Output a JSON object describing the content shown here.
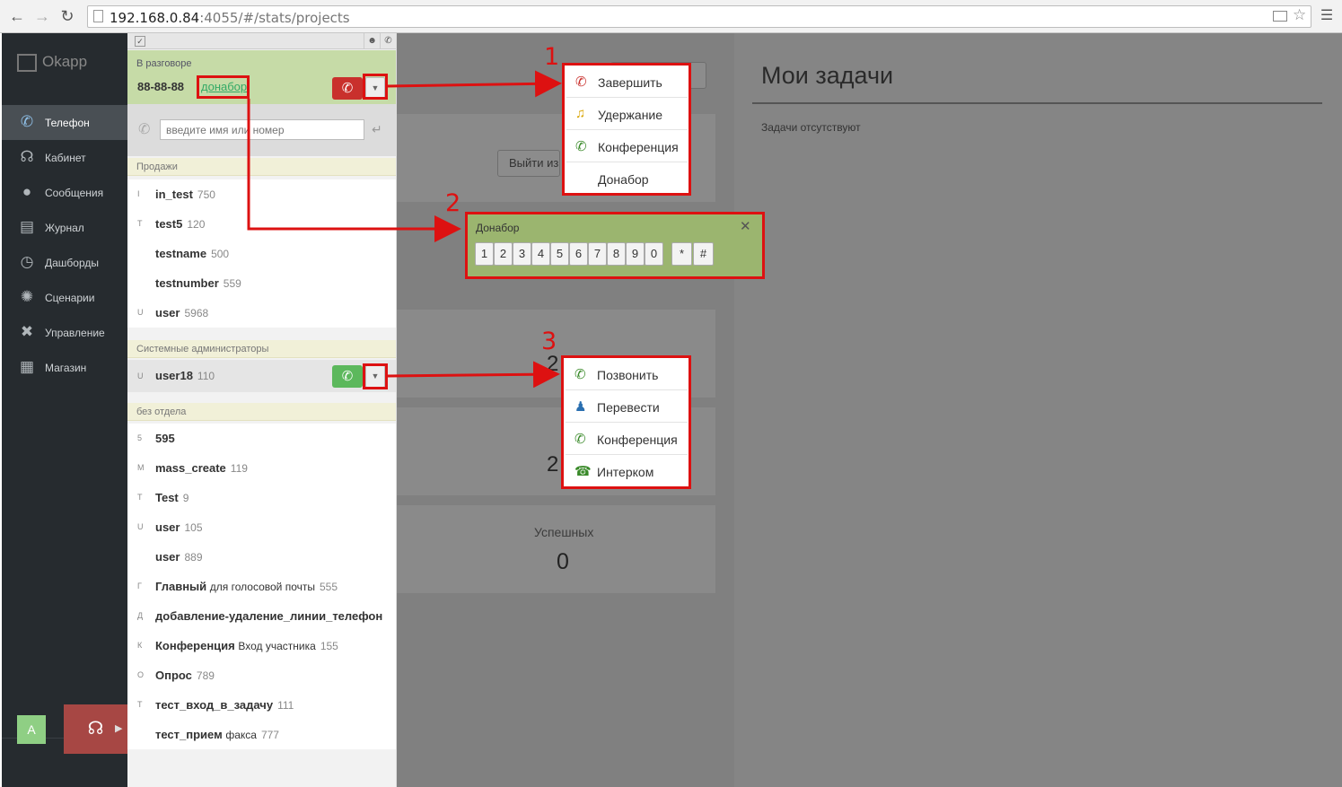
{
  "browser": {
    "url_host": "192.168.0.84",
    "url_path": ":4055/#/stats/projects"
  },
  "nav": {
    "logo": "Okapp",
    "items": [
      {
        "label": "Телефон",
        "icon": "phone-icon",
        "active": true
      },
      {
        "label": "Кабинет",
        "icon": "headset-icon"
      },
      {
        "label": "Сообщения",
        "icon": "chat-bubble-icon"
      },
      {
        "label": "Журнал",
        "icon": "journal-icon"
      },
      {
        "label": "Дашборды",
        "icon": "dashboard-icon"
      },
      {
        "label": "Сценарии",
        "icon": "scenario-icon"
      },
      {
        "label": "Управление",
        "icon": "tools-icon"
      },
      {
        "label": "Магазин",
        "icon": "grid-icon"
      }
    ],
    "avatar": "A"
  },
  "call": {
    "status": "В разговоре",
    "number": "88-88-88",
    "link": "донабор"
  },
  "search": {
    "placeholder": "введите имя или номер"
  },
  "groups": {
    "sales": {
      "title": "Продажи",
      "rows": [
        {
          "ini": "I",
          "name": "in_test",
          "ext": "750"
        },
        {
          "ini": "T",
          "name": "test5",
          "ext": "120"
        },
        {
          "ini": "",
          "name": "testname",
          "ext": "500"
        },
        {
          "ini": "",
          "name": "testnumber",
          "ext": "559"
        },
        {
          "ini": "U",
          "name": "user",
          "ext": "5968"
        }
      ]
    },
    "admins": {
      "title": "Системные администраторы",
      "rows": [
        {
          "ini": "U",
          "name": "user18",
          "ext": "110"
        }
      ]
    },
    "nodept": {
      "title": "без отдела",
      "rows": [
        {
          "ini": "5",
          "name": "595",
          "extra": "",
          "ext": ""
        },
        {
          "ini": "M",
          "name": "mass_create",
          "extra": "",
          "ext": "119"
        },
        {
          "ini": "T",
          "name": "Test",
          "extra": "",
          "ext": "9"
        },
        {
          "ini": "U",
          "name": "user",
          "extra": "",
          "ext": "105"
        },
        {
          "ini": "",
          "name": "user",
          "extra": "",
          "ext": "889"
        },
        {
          "ini": "Г",
          "name": "Главный",
          "extra": "для голосовой почты",
          "ext": "555"
        },
        {
          "ini": "Д",
          "name": "добавление-удаление_линии_телефон",
          "extra": "",
          "ext": ""
        },
        {
          "ini": "К",
          "name": "Конференция",
          "extra": "Вход участника",
          "ext": "155"
        },
        {
          "ini": "О",
          "name": "Опрос",
          "extra": "",
          "ext": "789"
        },
        {
          "ini": "Т",
          "name": "тест_вход_в_задачу",
          "extra": "",
          "ext": "111"
        },
        {
          "ini": "",
          "name": "тест_прием",
          "extra": "факса",
          "ext": "777"
        }
      ]
    }
  },
  "main": {
    "logout_btn": "Выйти из",
    "stat_digit_1": "2",
    "stat_digit_2": "2",
    "success_label": "Успешных",
    "success_value": "0"
  },
  "tasks": {
    "title": "Мои задачи",
    "empty": "Задачи отсутствуют"
  },
  "menu_call": [
    {
      "label": "Завершить",
      "icon": "hangup-icon",
      "color": "#c9302c"
    },
    {
      "label": "Удержание",
      "icon": "music-note-icon",
      "color": "#d9a400"
    },
    {
      "label": "Конференция",
      "icon": "phone-plus-icon",
      "color": "#3a8a2a"
    },
    {
      "label": "Донабор",
      "icon": "",
      "color": ""
    }
  ],
  "dialpad": {
    "title": "Донабор",
    "keys": [
      "1",
      "2",
      "3",
      "4",
      "5",
      "6",
      "7",
      "8",
      "9",
      "0"
    ],
    "special": [
      "*",
      "#"
    ]
  },
  "menu_contact": [
    {
      "label": "Позвонить",
      "icon": "phone-icon",
      "color": "#3a8a2a"
    },
    {
      "label": "Перевести",
      "icon": "transfer-user-icon",
      "color": "#2a6fb0"
    },
    {
      "label": "Конференция",
      "icon": "phone-plus-icon",
      "color": "#3a8a2a"
    },
    {
      "label": "Интерком",
      "icon": "intercom-icon",
      "color": "#3a8a2a"
    }
  ],
  "annotations": [
    "1",
    "2",
    "3"
  ],
  "colors": {
    "annotation_red": "#dd1111",
    "call_bar": "#c6dba7",
    "nav_bg": "#262b2f"
  }
}
